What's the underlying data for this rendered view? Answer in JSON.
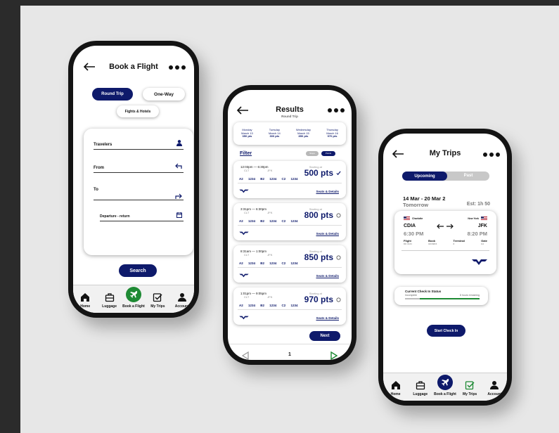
{
  "colors": {
    "navy": "#0e1a6b",
    "green": "#1e8a34",
    "bg": "#e7e7e7"
  },
  "phone1": {
    "title": "Book a Flight",
    "toggle_round": "Round Trip",
    "toggle_oneway": "One-Way",
    "toggle_hotels": "Fights & Hotels",
    "travelers_label": "Travelers",
    "from_label": "From",
    "to_label": "To",
    "departure_label": "Departure - return",
    "search_label": "Search",
    "tabs": [
      "Home",
      "Luggage",
      "Book a Flight",
      "My Trips",
      "Account"
    ]
  },
  "phone2": {
    "title": "Results",
    "subtitle": "Round Trip",
    "dates": [
      {
        "day": "Monday",
        "date": "March 13",
        "pts": "350 pts"
      },
      {
        "day": "Tuesday",
        "date": "March 14",
        "pts": "300 pts"
      },
      {
        "day": "Wednesday",
        "date": "March 15",
        "pts": "850 pts"
      },
      {
        "day": "Thursday",
        "date": "March 16",
        "pts": "970 pts"
      }
    ],
    "filter_label": "Filter",
    "pill_left": "Stops",
    "pill_right": "Points",
    "results": [
      {
        "time": "12:03pm — 6:30pm",
        "from": "CLT",
        "to": "JFK",
        "starting": "Starting at",
        "pts": "500 pts",
        "codes": "A2 1234  B2 1234  C2 1234",
        "seats": "Seats & Details",
        "selected": true
      },
      {
        "time": "3:31pm — 6:30pm",
        "from": "CLT",
        "to": "JFK",
        "starting": "Starting at",
        "pts": "800 pts",
        "codes": "A2 1234  B2 1234  C2 1234",
        "seats": "Seats & Details",
        "selected": false
      },
      {
        "time": "8:31am — 1:00pm",
        "from": "CLT",
        "to": "JFK",
        "starting": "Starting at",
        "pts": "850 pts",
        "codes": "A2 1234  B2 1234  C2 1234",
        "seats": "Seats & Details",
        "selected": false
      },
      {
        "time": "1:01pm — 9:05pm",
        "from": "CLT",
        "to": "JFK",
        "starting": "Starting at",
        "pts": "970 pts",
        "codes": "A2 1234  B2 1234  C2 1234",
        "seats": "Seats & Details",
        "selected": false
      }
    ],
    "next_label": "Next",
    "page_number": "1"
  },
  "phone3": {
    "title": "My Trips",
    "tab_upcoming": "Upcoming",
    "tab_past": "Past",
    "trip_dates": "14 Mar - 20 Mar 2",
    "trip_when": "Tomorrow",
    "trip_est": "Est: 1h 50",
    "from_city": "Charlotte",
    "to_city": "New York",
    "from_code": "CDIA",
    "to_code": "JFK",
    "dep_time": "6:30 PM",
    "arr_time": "8:20 PM",
    "col_flight": "Flight",
    "col_book": "Book",
    "col_terminal": "Terminal",
    "col_gate": "Gate",
    "val_flight": "DK 0134",
    "val_book": "GKD9D3",
    "val_terminal": "8",
    "val_gate": "G4",
    "checkin_title": "Current Check In Status",
    "checkin_state": "Incomplete",
    "checkin_remaining": "8 hours remaining",
    "checkin_progress": 0.2,
    "start_checkin": "Start Check In",
    "tabs": [
      "Home",
      "Luggage",
      "Book a Flight",
      "My Trips",
      "Account"
    ]
  }
}
